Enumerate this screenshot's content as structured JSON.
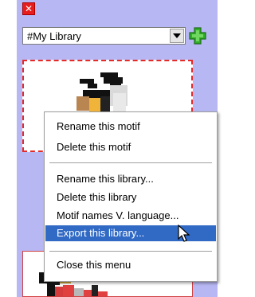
{
  "toolbar": {
    "close_glyph": "✕",
    "library_selected": "#My Library"
  },
  "context_menu": {
    "items": [
      {
        "label": "Rename this motif"
      },
      {
        "label": "Delete this motif"
      },
      {
        "label": "Rename this library..."
      },
      {
        "label": "Delete this library"
      },
      {
        "label": "Motif names V. language..."
      },
      {
        "label": "Export this library..."
      },
      {
        "label": "Close this menu"
      }
    ],
    "highlighted_index": 5
  },
  "colors": {
    "panel_bg": "#b7b7f3",
    "selection": "#316ac5",
    "close_red": "#e81c1c",
    "add_green": "#2fae28"
  }
}
